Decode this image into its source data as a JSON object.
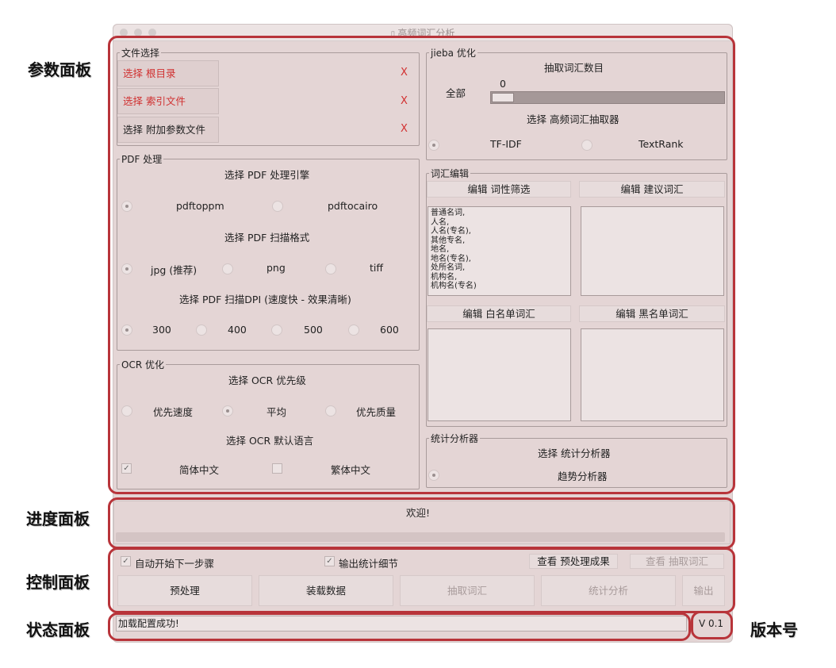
{
  "window": {
    "title": "高频词汇分析"
  },
  "annotations": {
    "params": "参数面板",
    "progress": "进度面板",
    "control": "控制面板",
    "status": "状态面板",
    "version": "版本号"
  },
  "file_select": {
    "group_label": "文件选择",
    "items": [
      {
        "label": "选择 根目录",
        "remove": "X"
      },
      {
        "label": "选择 索引文件",
        "remove": "X"
      },
      {
        "label": "选择 附加参数文件",
        "remove": "X"
      }
    ]
  },
  "pdf": {
    "group_label": "PDF 处理",
    "engine_title": "选择 PDF 处理引擎",
    "engines": [
      "pdftoppm",
      "pdftocairo"
    ],
    "format_title": "选择 PDF 扫描格式",
    "formats": [
      "jpg (推荐)",
      "png",
      "tiff"
    ],
    "dpi_title": "选择 PDF 扫描DPI (速度快 - 效果清晰)",
    "dpis": [
      "300",
      "400",
      "500",
      "600"
    ]
  },
  "ocr": {
    "group_label": "OCR 优化",
    "priority_title": "选择 OCR 优先级",
    "priorities": [
      "优先速度",
      "平均",
      "优先质量"
    ],
    "lang_title": "选择 OCR 默认语言",
    "langs": [
      "简体中文",
      "繁体中文"
    ]
  },
  "jieba": {
    "group_label": "jieba 优化",
    "count_title": "抽取词汇数目",
    "all_label": "全部",
    "slider_value": "0",
    "extractor_title": "选择 高频词汇抽取器",
    "extractors": [
      "TF-IDF",
      "TextRank"
    ]
  },
  "vocab": {
    "group_label": "词汇编辑",
    "pos_button": "编辑 词性筛选",
    "suggest_button": "编辑 建议词汇",
    "pos_list": [
      "普通名词,",
      "人名,",
      "人名(专名),",
      "其他专名,",
      "地名,",
      "地名(专名),",
      "处所名词,",
      "机构名,",
      "机构名(专名)"
    ],
    "white_button": "编辑 白名单词汇",
    "black_button": "编辑 黑名单词汇"
  },
  "stats": {
    "group_label": "统计分析器",
    "title": "选择 统计分析器",
    "option": "趋势分析器"
  },
  "progress": {
    "message": "欢迎!",
    "value": 0
  },
  "control": {
    "auto_next": "自动开始下一步骤",
    "output_details": "输出统计细节",
    "view_preprocess": "查看 预处理成果",
    "view_extract": "查看 抽取词汇",
    "buttons": [
      "预处理",
      "装载数据",
      "抽取词汇",
      "统计分析",
      "输出"
    ]
  },
  "status": {
    "message": "加载配置成功!",
    "version": "V 0.1"
  }
}
